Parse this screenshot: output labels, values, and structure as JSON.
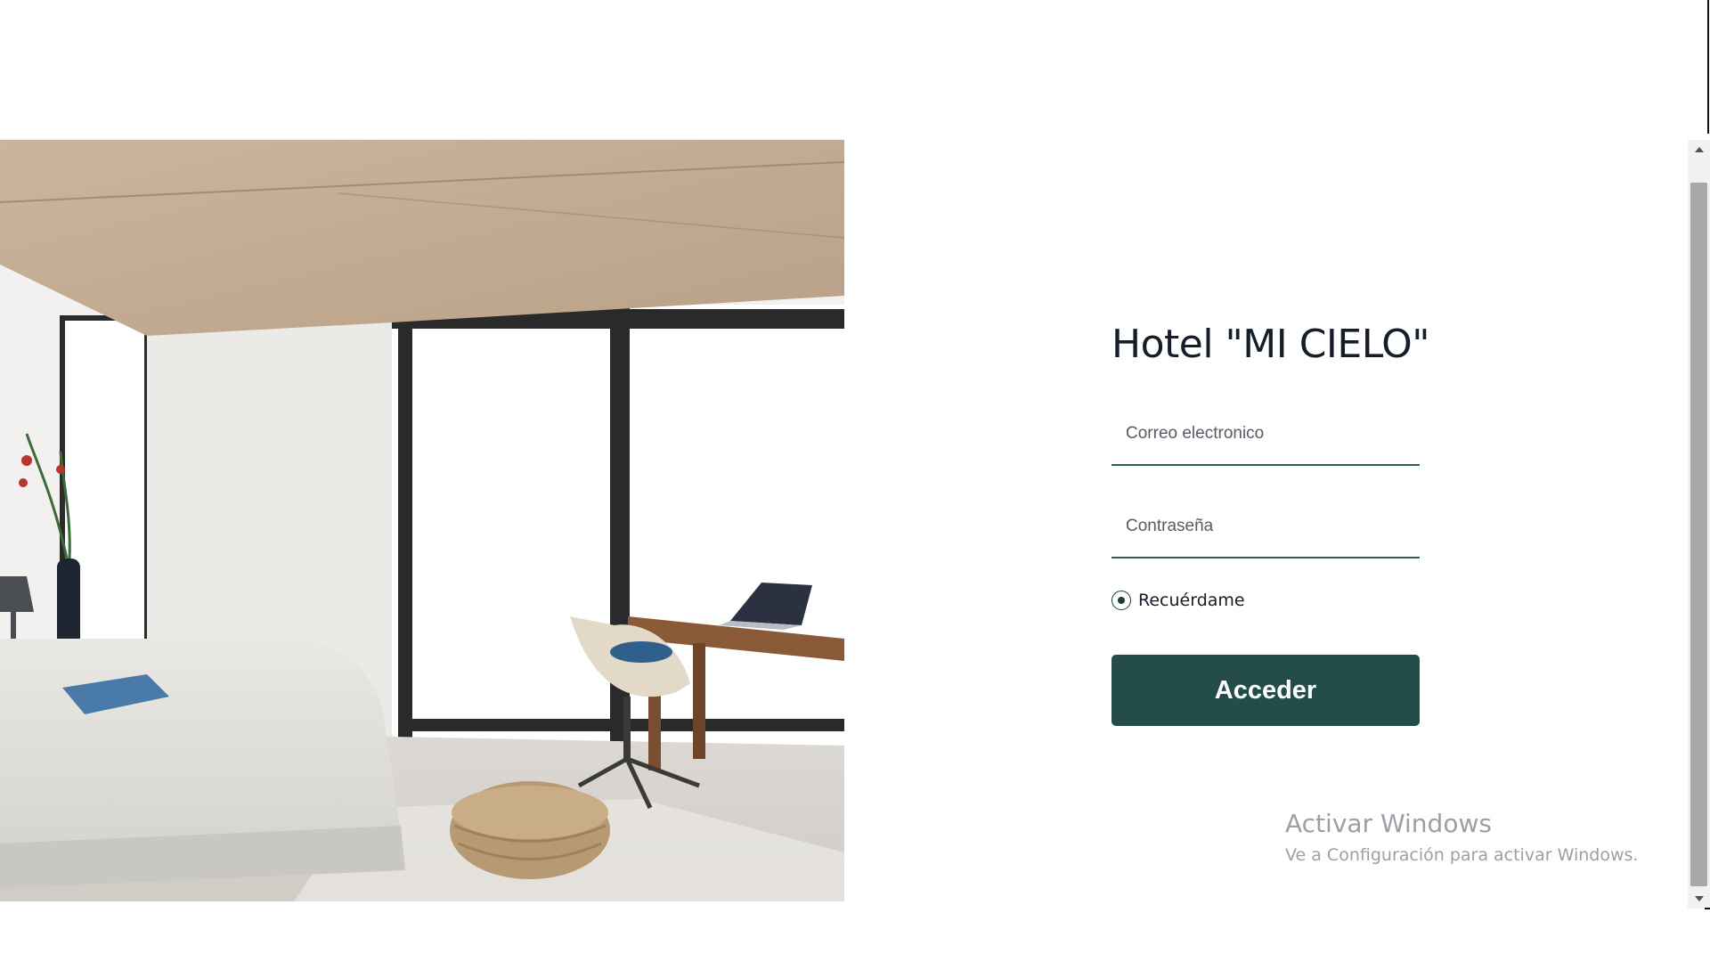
{
  "hero": {
    "image_alt": "Habitación de hotel con cama, escritorio, silla y ventanales"
  },
  "login": {
    "title": "Hotel \"MI CIELO\"",
    "email_placeholder": "Correo electronico",
    "email_value": "",
    "password_placeholder": "Contraseña",
    "password_value": "",
    "remember_label": "Recuérdame",
    "remember_checked": true,
    "submit_label": "Acceder"
  },
  "watermark": {
    "title": "Activar Windows",
    "subtitle": "Ve a Configuración para activar Windows."
  },
  "colors": {
    "accent": "#234c4a",
    "field_underline": "#2f5d59",
    "title_text": "#151d29",
    "watermark_text": "#9aa0a6"
  },
  "icons": {
    "remember_control": "radio-selected-icon",
    "scroll_up": "triangle-up-icon",
    "scroll_down": "triangle-down-icon"
  }
}
